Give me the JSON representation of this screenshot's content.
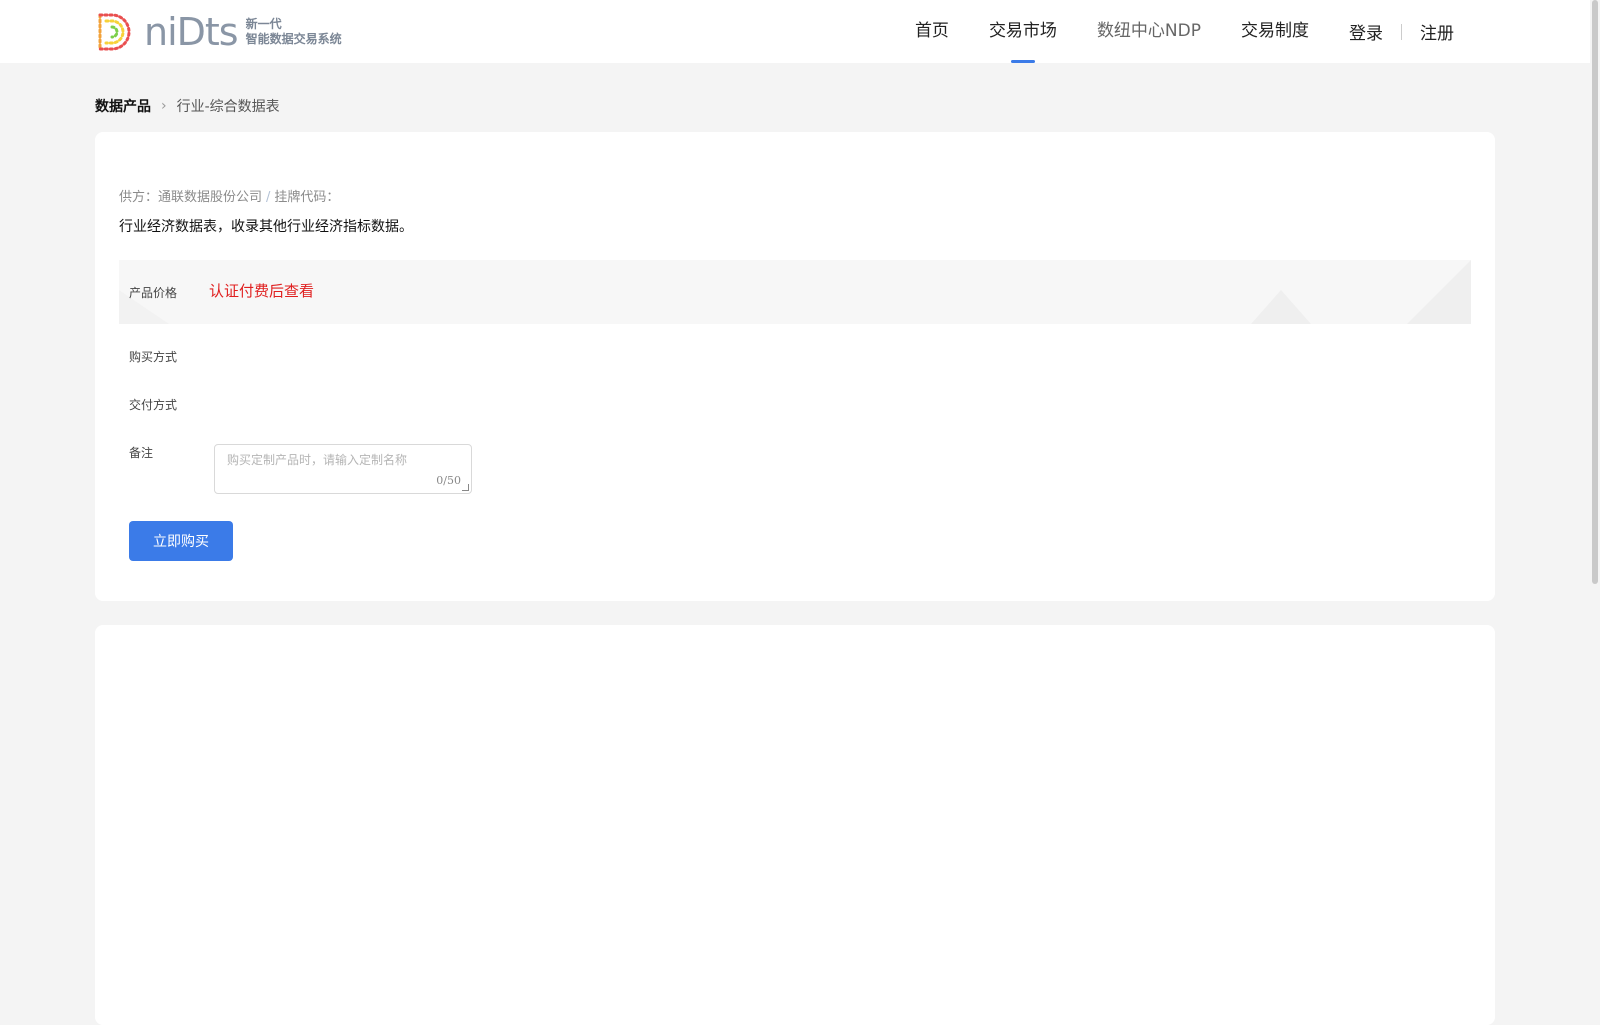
{
  "brand": {
    "wordmark": "niDts",
    "tagline_line1": "新一代",
    "tagline_line2": "智能数据交易系统"
  },
  "nav": {
    "items": [
      {
        "label": "首页"
      },
      {
        "label": "交易市场",
        "active": true
      },
      {
        "label": "数纽中心NDP"
      },
      {
        "label": "交易制度"
      }
    ],
    "login": "登录",
    "register": "注册"
  },
  "breadcrumb": {
    "root": "数据产品",
    "leaf": "行业-综合数据表"
  },
  "product": {
    "supplier_prefix": "供方：",
    "supplier_name": "通联数据股份公司",
    "separator": "/",
    "listing_code_label": "挂牌代码：",
    "description": "行业经济数据表，收录其他行业经济指标数据。",
    "price_label": "产品价格",
    "price_value": "认证付费后查看",
    "buy_method_label": "购买方式",
    "delivery_label": "交付方式",
    "note_label": "备注",
    "note_placeholder": "购买定制产品时，请输入定制名称",
    "note_counter": "0/50",
    "buy_button": "立即购买"
  },
  "colors": {
    "accent": "#3b7be8",
    "price_red": "#e02020"
  }
}
